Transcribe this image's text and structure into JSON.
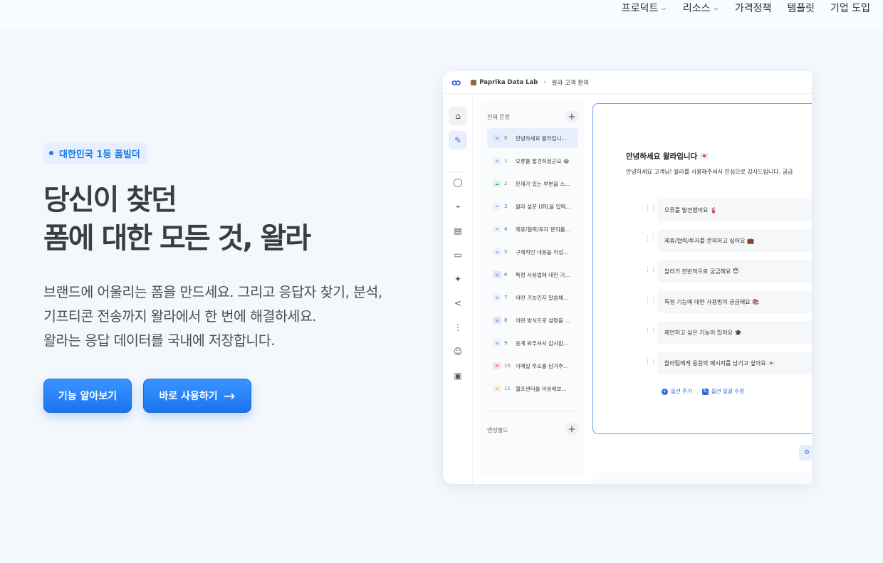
{
  "nav": {
    "items": [
      {
        "label": "프로덕트",
        "dropdown": true
      },
      {
        "label": "리소스",
        "dropdown": true
      },
      {
        "label": "가격정책",
        "dropdown": false
      },
      {
        "label": "템플릿",
        "dropdown": false
      },
      {
        "label": "기업 도입",
        "dropdown": false
      }
    ]
  },
  "hero": {
    "badge": "대한민국 1등 폼빌더",
    "headline_line1": "당신이 찾던",
    "headline_line2": "폼에 대한 모든 것, 왈라",
    "desc_line1": "브랜드에 어울리는 폼을 만드세요. 그리고 응답자 찾기, 분석,",
    "desc_line2": "기프티콘 전송까지 왈라에서 한 번에 해결하세요.",
    "desc_line3": "왈라는 응답 데이터를 국내에 저장합니다.",
    "primary_button": "기능 알아보기",
    "secondary_button": "바로 사용하기",
    "secondary_arrow": "→"
  },
  "mockup": {
    "logo": "ꝏ",
    "workspace": "Paprika Data Lab",
    "breadcrumb_sep": "›",
    "page": "왈라 고객 문의",
    "question_header": "전체 문항",
    "ending_header": "엔딩필드",
    "plus": "+",
    "questions": [
      {
        "num": "0",
        "text": "안녕하세요 왈라입니...",
        "tag_color": "#5b7be0",
        "tag_bg": "#dfe6fb",
        "tag": "≡",
        "active": true
      },
      {
        "num": "1",
        "text": "오류를 발견하셨군요 😂",
        "tag_color": "#5b7be0",
        "tag_bg": "#eef2fc",
        "tag": "≡"
      },
      {
        "num": "2",
        "text": "문제가 있는 부분을 스...",
        "tag_color": "#3aa55a",
        "tag_bg": "#e4f4e8",
        "tag": "☁"
      },
      {
        "num": "3",
        "text": "왈라 설문 URL을 입력...",
        "tag_color": "#5b7be0",
        "tag_bg": "#eef2fc",
        "tag": "═"
      },
      {
        "num": "4",
        "text": "제휴/협력/투자 문의를...",
        "tag_color": "#5b7be0",
        "tag_bg": "#eef2fc",
        "tag": "═"
      },
      {
        "num": "5",
        "text": "구체적인 내용을 작성...",
        "tag_color": "#5b7be0",
        "tag_bg": "#eef2fc",
        "tag": "≡"
      },
      {
        "num": "6",
        "text": "특정 사용법에 대한 기...",
        "tag_color": "#5b7be0",
        "tag_bg": "#dfe6fb",
        "tag": "≡"
      },
      {
        "num": "7",
        "text": "어떤 기능인지 말씀해...",
        "tag_color": "#5b7be0",
        "tag_bg": "#eef2fc",
        "tag": "≡"
      },
      {
        "num": "8",
        "text": "어떤 방식으로 설명을 ...",
        "tag_color": "#5b7be0",
        "tag_bg": "#dfe6fb",
        "tag": "≡"
      },
      {
        "num": "9",
        "text": "응계 봐주셔서 감사합...",
        "tag_color": "#5b7be0",
        "tag_bg": "#eef2fc",
        "tag": "≡"
      },
      {
        "num": "10",
        "text": "이메일 주소를 남겨주...",
        "tag_color": "#e04848",
        "tag_bg": "#fbe3e3",
        "tag": "✉"
      },
      {
        "num": "11",
        "text": "헬프센터를 이용해보...",
        "tag_color": "#e0a048",
        "tag_bg": "#fbf0e0",
        "tag": "≡"
      }
    ],
    "editor": {
      "title": "안녕하세요 왈라입니다 💌",
      "subtitle": "안녕하세요 고객님! 왈라를 사용해주셔서 진심으로 감사드립니다. 궁금",
      "options": [
        "오류를 발견했어요 🧯",
        "제휴/협력/투자를 문의하고 싶어요 💼",
        "왈라가 전반적으로 궁금해요 😇",
        "특정 기능에 대한 사용법이 궁금해요 📚",
        "제안하고 싶은 기능이 있어요 🎓",
        "왈라팀에게 응원의 메시지를 남기고 싶어요 💌"
      ],
      "add_option": "옵션 추가",
      "bulk_edit": "옵션 일괄 수정"
    },
    "sidebar_icons": [
      "home-icon",
      "edit-icon",
      "donut-icon",
      "trend-icon",
      "doc-icon",
      "comment-icon",
      "sparkle-icon",
      "share-icon",
      "flow-icon",
      "people-icon",
      "gift-icon"
    ]
  }
}
